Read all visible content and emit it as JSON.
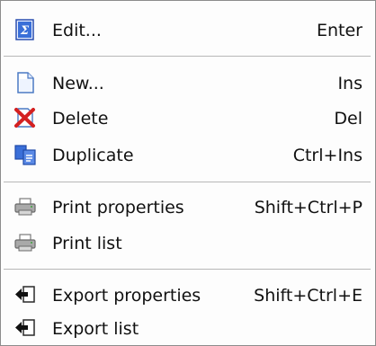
{
  "menu": {
    "items": [
      {
        "label": "Edit...",
        "shortcut": "Enter",
        "icon": "edit-icon"
      },
      {
        "label": "New...",
        "shortcut": "Ins",
        "icon": "new-document-icon"
      },
      {
        "label": "Delete",
        "shortcut": "Del",
        "icon": "delete-icon"
      },
      {
        "label": "Duplicate",
        "shortcut": "Ctrl+Ins",
        "icon": "duplicate-icon"
      },
      {
        "label": "Print properties",
        "shortcut": "Shift+Ctrl+P",
        "icon": "printer-icon"
      },
      {
        "label": "Print list",
        "shortcut": "",
        "icon": "printer-icon"
      },
      {
        "label": "Export properties",
        "shortcut": "Shift+Ctrl+E",
        "icon": "export-icon"
      },
      {
        "label": "Export list",
        "shortcut": "",
        "icon": "export-icon"
      }
    ]
  }
}
